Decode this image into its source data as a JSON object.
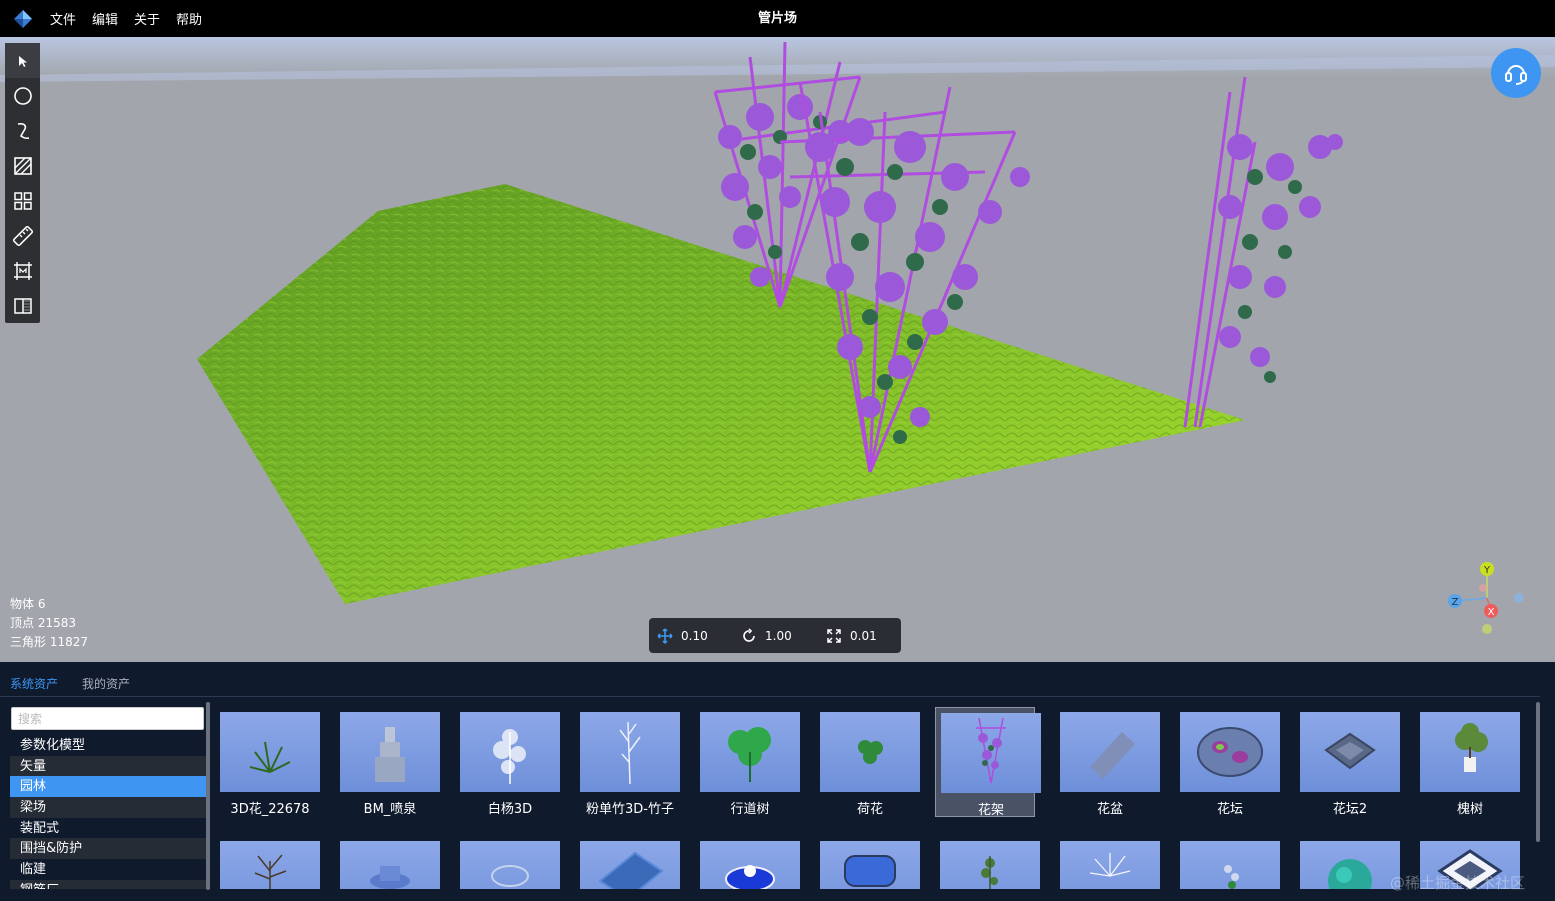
{
  "app": {
    "title": "管片场"
  },
  "menu": [
    "文件",
    "编辑",
    "关于",
    "帮助"
  ],
  "toolbar": [
    "select-arrow-icon",
    "circle-icon",
    "curve-icon",
    "hatch-area-icon",
    "grid-icon",
    "ruler-icon",
    "frame-icon",
    "split-view-icon"
  ],
  "stats": {
    "objects": "物体 6",
    "vertices": "顶点 21583",
    "triangles": "三角形 11827"
  },
  "transform": {
    "move": "0.10",
    "rotate": "1.00",
    "scale": "0.01"
  },
  "gizmo": {
    "y": "Y",
    "z": "Z",
    "x": "X"
  },
  "asset_panel": {
    "tabs": [
      "系统资产",
      "我的资产"
    ],
    "active_tab": 0,
    "search_placeholder": "搜索",
    "categories": [
      "参数化模型",
      "矢量",
      "园林",
      "梁场",
      "装配式",
      "围挡&防护",
      "临建",
      "钢筋厂"
    ],
    "selected_category": 2,
    "assets": [
      {
        "label": "3D花_22678"
      },
      {
        "label": "BM_喷泉"
      },
      {
        "label": "白杨3D"
      },
      {
        "label": "粉单竹3D-竹子"
      },
      {
        "label": "行道树"
      },
      {
        "label": "荷花"
      },
      {
        "label": "花架",
        "selected": true
      },
      {
        "label": "花盆"
      },
      {
        "label": "花坛"
      },
      {
        "label": "花坛2"
      },
      {
        "label": "槐树"
      }
    ]
  },
  "watermark": "@稀土掘金技术社区",
  "colors": {
    "accent": "#3e96f2",
    "topbar": "#000000",
    "viewport": "#a2a6ac",
    "panel": "#0f1a2c",
    "grass": "#7fc023",
    "flower": "#9b59d9"
  }
}
